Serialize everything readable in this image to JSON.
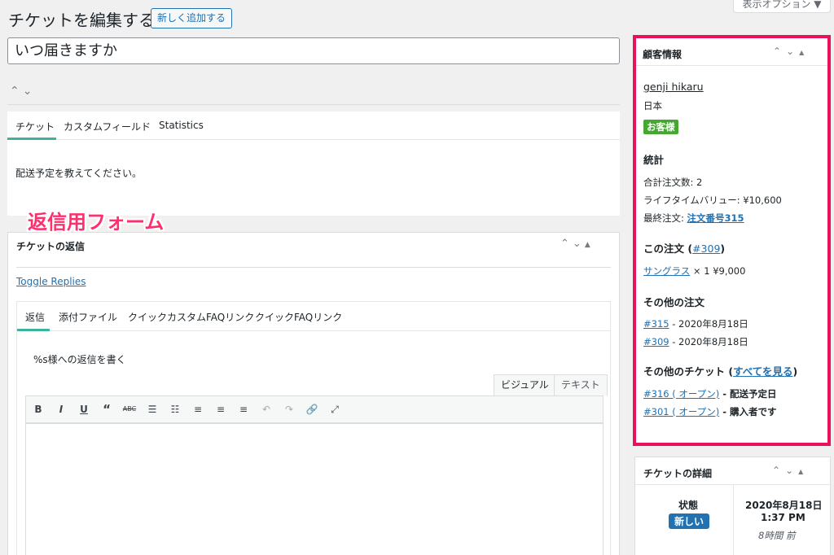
{
  "header": {
    "page_title": "チケットを編集する",
    "add_new": "新しく追加する",
    "screen_options": "表示オプション ▼"
  },
  "ticket": {
    "title_value": "いつ届きますか",
    "tabs": [
      "チケット",
      "カスタムフィールド",
      "Statistics"
    ],
    "body": "配送予定を教えてください。"
  },
  "reply": {
    "box_title": "チケットの返信",
    "toggle_replies": "Toggle Replies",
    "tabs": [
      "返信",
      "添付ファイル",
      "クイックカスタムFAQリンク",
      "クイックFAQリンク"
    ],
    "write_placeholder": "%s様への返信を書く",
    "editor_tabs": [
      "ビジュアル",
      "テキスト"
    ],
    "overlay_label": "返信用フォーム"
  },
  "customer": {
    "box_title": "顧客情報",
    "name": "genji hikaru",
    "country": "日本",
    "badge": "お客様",
    "stats_heading": "統計",
    "total_orders": "合計注文数: 2",
    "lifetime_value": "ライフタイムバリュー: ¥10,600",
    "last_order_label": "最終注文: ",
    "last_order_link": "注文番号315",
    "this_order_label": "この注文 (",
    "this_order_link": "#309",
    "this_order_close": ")",
    "item_link": "サングラス",
    "item_detail": " × 1 ¥9,000",
    "other_orders_heading": "その他の注文",
    "other_orders": [
      {
        "link": "#315",
        "date": " - 2020年8月18日"
      },
      {
        "link": "#309",
        "date": " - 2020年8月18日"
      }
    ],
    "other_tickets_label": "その他のチケット (",
    "see_all": "すべてを見る",
    "other_tickets_close": ")",
    "other_tickets": [
      {
        "link": "#316 ( オープン)",
        "subject": " - 配送予定日"
      },
      {
        "link": "#301 ( オープン)",
        "subject": " - 購入者です"
      }
    ]
  },
  "details": {
    "box_title": "チケットの詳細",
    "status_label": "状態",
    "status_value": "新しい",
    "date": "2020年8月18日",
    "time": "1:37 PM",
    "ago": "8時間 前"
  },
  "colors": {
    "accent": "#2271b1",
    "highlight_border": "#e8115a",
    "overlay_text": "#ff2f6d",
    "customer_badge": "#46a832",
    "tab_underline": "#3db39e"
  }
}
